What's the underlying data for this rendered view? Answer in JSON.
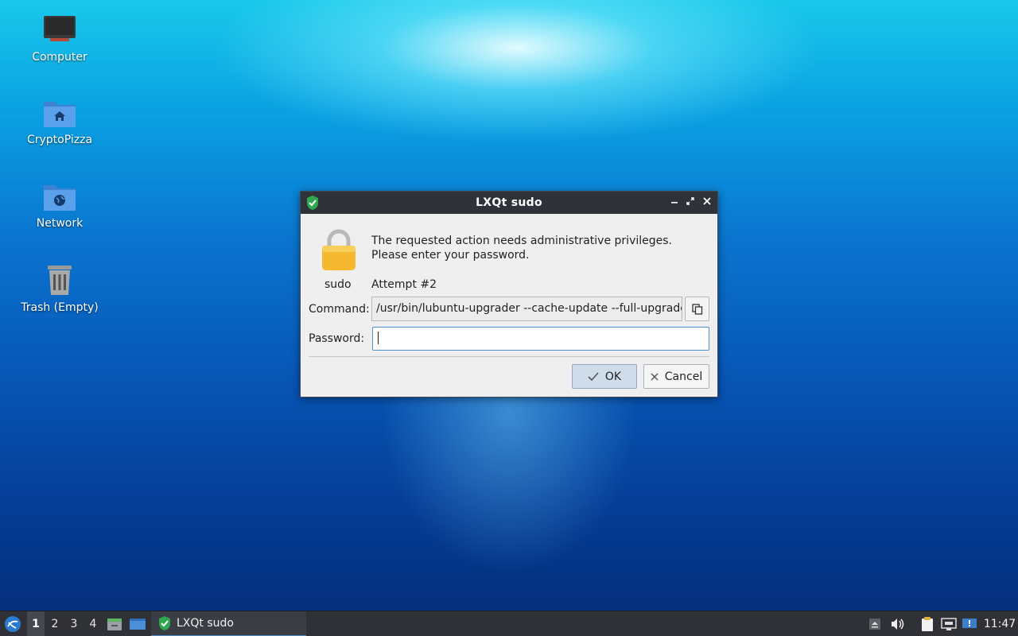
{
  "desktop": {
    "icons": [
      {
        "label": "Computer"
      },
      {
        "label": "CryptoPizza"
      },
      {
        "label": "Network"
      },
      {
        "label": "Trash (Empty)"
      }
    ]
  },
  "dialog": {
    "title": "LXQt sudo",
    "message_line1": "The requested action needs administrative privileges.",
    "message_line2": "Please enter your password.",
    "user_label": "sudo",
    "attempt": "Attempt #2",
    "command_label": "Command:",
    "command_value": "/usr/bin/lubuntu-upgrader --cache-update --full-upgrade",
    "password_label": "Password:",
    "password_value": "",
    "ok_label": "OK",
    "cancel_label": "Cancel"
  },
  "taskbar": {
    "workspaces": [
      "1",
      "2",
      "3",
      "4"
    ],
    "active_workspace": "1",
    "task_label": "LXQt sudo",
    "clock": "11:47"
  },
  "colors": {
    "titlebar": "#2f3238",
    "dialog_bg": "#efefef",
    "accent": "#4e8fcf",
    "taskbar": "#2f3136"
  }
}
